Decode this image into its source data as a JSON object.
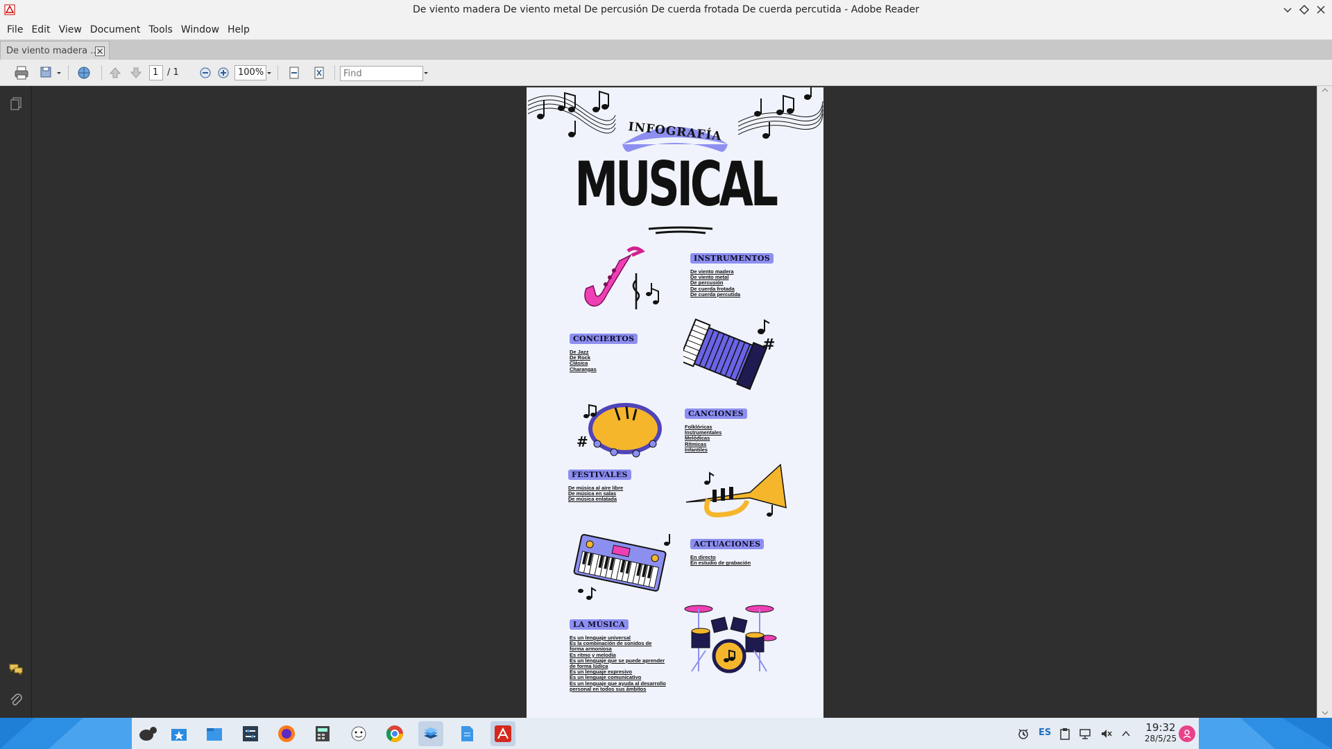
{
  "window": {
    "title": "De viento madera De viento metal De percusión De cuerda frotada De cuerda percutida - Adobe Reader"
  },
  "menu": [
    "File",
    "Edit",
    "View",
    "Document",
    "Tools",
    "Window",
    "Help"
  ],
  "tab": {
    "label": "De viento madera ..."
  },
  "toolbar": {
    "page_current": "1",
    "page_total": "/ 1",
    "zoom": "100%",
    "find_placeholder": "Find"
  },
  "document": {
    "banner": "INFOGRAFÍA",
    "heading": "MUSICAL",
    "sections": [
      {
        "title": "INSTRUMENTOS",
        "items": [
          "De viento madera",
          "De viento metal",
          "De percusión",
          "De cuerda frotada",
          "De cuerda percutida"
        ]
      },
      {
        "title": "CONCIERTOS",
        "items": [
          "De Jazz",
          "De Rock",
          "Clásica",
          "Charangas"
        ]
      },
      {
        "title": "CANCIONES",
        "items": [
          "Folklóricas",
          "Instrumentales",
          "Melódicas",
          "Rítmicas",
          "Infantiles"
        ]
      },
      {
        "title": "FESTIVALES",
        "items": [
          "De música al aire libre",
          "De música en salas",
          "De música enlatada"
        ]
      },
      {
        "title": "ACTUACIONES",
        "items": [
          "En directo",
          "En estudio de grabación"
        ]
      },
      {
        "title": "LA MÚSICA",
        "items": [
          "Es un lenguaje universal",
          "Es la combinación de sonidos de forma armoniosa",
          "Es ritmo y melodía",
          "Es un lenguaje que se puede aprender de forma lúdica",
          "Es un lenguaje expresivo",
          "Es un lenguaje comunicativo",
          "Es un lenguaje que ayuda al desarrollo personal en todos sus ámbitos"
        ]
      }
    ]
  },
  "taskbar": {
    "language": "ES",
    "time": "19:32",
    "date": "28/5/25"
  },
  "colors": {
    "accent_pill": "#8d8ff0",
    "page_bg": "#f0f3fb",
    "viewer_bg": "#2f2f2f",
    "taskbar_blue": "#1f7fd6"
  }
}
